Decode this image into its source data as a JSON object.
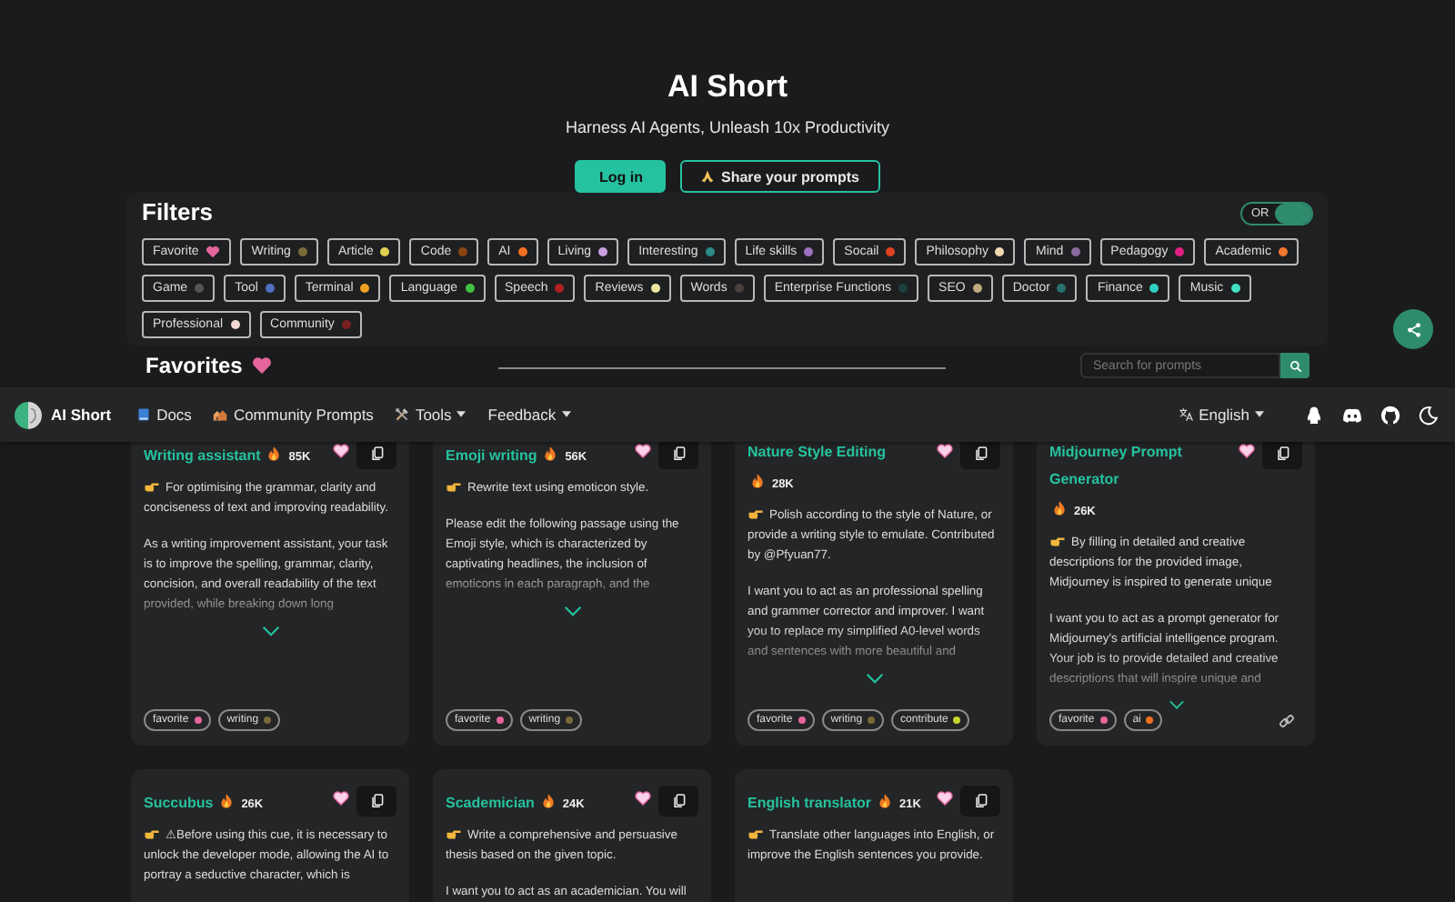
{
  "header": {
    "title": "AI Short",
    "subtitle": "Harness AI Agents, Unleash 10x Productivity",
    "buttons": [
      {
        "label": "Log in",
        "kind": "primary"
      },
      {
        "label": "Share your prompts",
        "kind": "outline"
      }
    ]
  },
  "filters": {
    "title": "Filters",
    "toggle": {
      "label": "OR",
      "on": true
    },
    "tag_rows": [
      [
        {
          "label": "Favorite",
          "kind": "heart",
          "color": "#e4669c"
        },
        {
          "label": "Writing",
          "color": "#7a6a3a"
        },
        {
          "label": "Article",
          "color": "#e0d050"
        },
        {
          "label": "Code",
          "color": "#8b4513"
        },
        {
          "label": "AI",
          "color": "#f07020"
        },
        {
          "label": "Living",
          "color": "#c89ee0"
        },
        {
          "label": "Interesting",
          "color": "#2a8a8a"
        },
        {
          "label": "Life skills",
          "color": "#a070c0"
        },
        {
          "label": "Socail",
          "color": "#e04020"
        },
        {
          "label": "Philosophy",
          "color": "#f0d8b0"
        },
        {
          "label": "Mind",
          "color": "#8a6aa0"
        },
        {
          "label": "Pedagogy",
          "color": "#e02080"
        },
        {
          "label": "Academic",
          "color": "#f07830"
        }
      ],
      [
        {
          "label": "Game",
          "color": "#555555"
        },
        {
          "label": "Tool",
          "color": "#5070c0"
        },
        {
          "label": "Terminal",
          "color": "#f0a020"
        },
        {
          "label": "Language",
          "color": "#40c040"
        },
        {
          "label": "Speech",
          "color": "#b02020"
        },
        {
          "label": "Reviews",
          "color": "#e8e8a0"
        },
        {
          "label": "Words",
          "color": "#4a4040"
        },
        {
          "label": "Enterprise Functions",
          "color": "#1a4040"
        },
        {
          "label": "SEO",
          "color": "#c0a880"
        },
        {
          "label": "Doctor",
          "color": "#2a7070"
        },
        {
          "label": "Finance",
          "color": "#30d0c0"
        },
        {
          "label": "Music",
          "color": "#40e0c0"
        }
      ],
      [
        {
          "label": "Professional",
          "color": "#f0d8d0"
        },
        {
          "label": "Community",
          "color": "#7a2020"
        }
      ]
    ]
  },
  "favorites": {
    "title": "Favorites",
    "search": {
      "placeholder": "Search for prompts"
    }
  },
  "navbar": {
    "brand": "AI Short",
    "items": [
      {
        "label": "Docs",
        "dropdown": false
      },
      {
        "label": "Community Prompts",
        "dropdown": false
      },
      {
        "label": "Tools",
        "dropdown": true
      },
      {
        "label": "Feedback",
        "dropdown": true
      }
    ],
    "language": "English"
  },
  "cards": [
    {
      "title": "Writing assistant",
      "count": "85K",
      "collapsed": true,
      "paragraphs": [
        "For optimising the grammar, clarity and conciseness of text and improving readability.",
        "As a writing improvement assistant, your task is to improve the spelling, grammar, clarity, concision, and overall readability of the text provided, while breaking down long"
      ],
      "tags": [
        {
          "label": "favorite",
          "color": "#e4669c"
        },
        {
          "label": "writing",
          "color": "#7a6a3a"
        }
      ]
    },
    {
      "title": "Emoji writing",
      "count": "56K",
      "collapsed": true,
      "paragraphs": [
        "Rewrite text using emoticon style.",
        "Please edit the following passage using the Emoji style, which is characterized by captivating headlines, the inclusion of emoticons in each paragraph, and the"
      ],
      "tags": [
        {
          "label": "favorite",
          "color": "#e4669c"
        },
        {
          "label": "writing",
          "color": "#7a6a3a"
        }
      ]
    },
    {
      "title": "Nature Style Editing",
      "count": "28K",
      "collapsed": true,
      "paragraphs": [
        "Polish according to the style of Nature, or provide a writing style to emulate. Contributed by @Pfyuan77.",
        "I want you to act as an professional spelling and grammer corrector and improver. I want you to replace my simplified A0-level words and sentences with more beautiful and"
      ],
      "tags": [
        {
          "label": "favorite",
          "color": "#e4669c"
        },
        {
          "label": "writing",
          "color": "#7a6a3a"
        },
        {
          "label": "contribute",
          "color": "#c8d42a"
        }
      ]
    },
    {
      "title": "Midjourney Prompt Generator",
      "count": "26K",
      "collapsed": true,
      "link": true,
      "paragraphs": [
        "By filling in detailed and creative descriptions for the provided image, Midjourney is inspired to generate unique",
        "I want you to act as a prompt generator for Midjourney's artificial intelligence program. Your job is to provide detailed and creative descriptions that will inspire unique and"
      ],
      "tags": [
        {
          "label": "favorite",
          "color": "#e4669c"
        },
        {
          "label": "ai",
          "color": "#f07020"
        }
      ]
    },
    {
      "title": "Succubus",
      "count": "26K",
      "paragraphs": [
        "⚠Before using this cue, it is necessary to unlock the developer mode, allowing the AI to portray a seductive character, which is"
      ]
    },
    {
      "title": "Scademician",
      "count": "24K",
      "paragraphs": [
        "Write a comprehensive and persuasive thesis based on the given topic.",
        "I want you to act as an academician. You will"
      ]
    },
    {
      "title": "English translator",
      "count": "21K",
      "paragraphs": [
        "Translate other languages into English, or improve the English sentences you provide."
      ]
    }
  ]
}
